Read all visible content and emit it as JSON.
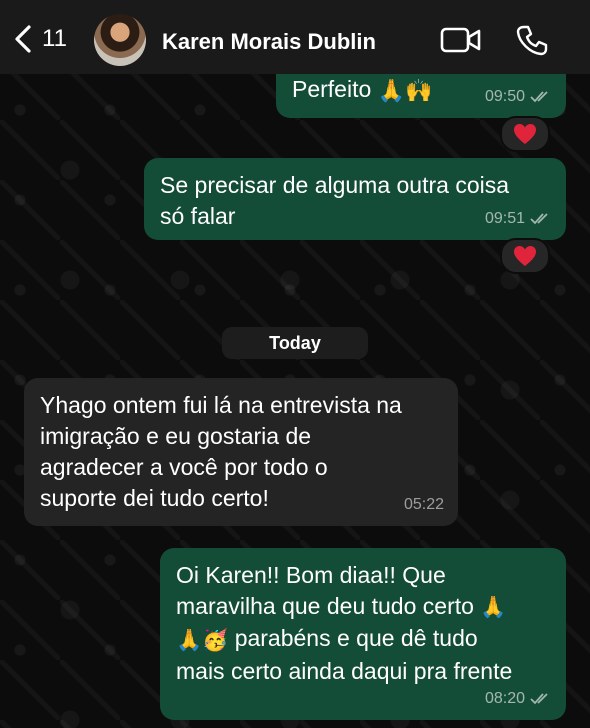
{
  "header": {
    "back_count": "11",
    "contact_name": "Karen Morais Dublin"
  },
  "messages": [
    {
      "direction": "out",
      "text": "Perfeito",
      "emoji": "🙏🙌",
      "time": "09:50",
      "reaction": "heart"
    },
    {
      "direction": "out",
      "lines": [
        "Se precisar de alguma outra coisa",
        "só falar"
      ],
      "time": "09:51",
      "reaction": "heart"
    },
    {
      "direction": "in",
      "lines": [
        "Yhago ontem fui lá na entrevista na",
        "imigração e eu gostaria de",
        "agradecer a você por todo o",
        "suporte dei tudo certo!"
      ],
      "time": "05:22"
    },
    {
      "direction": "out",
      "lines": [
        "Oi Karen!! Bom diaa!! Que",
        "maravilha que deu tudo certo",
        "parabéns e que dê tudo",
        "mais certo ainda daqui pra frente"
      ],
      "line2_emoji": "🙏",
      "line3_emoji": "🙏🥳",
      "time": "08:20"
    }
  ],
  "date_separator": "Today",
  "colors": {
    "outgoing_bubble": "#144d37",
    "incoming_bubble": "#242424",
    "header_bg": "#1a1a1a",
    "reaction_heart": "#e0243b"
  }
}
